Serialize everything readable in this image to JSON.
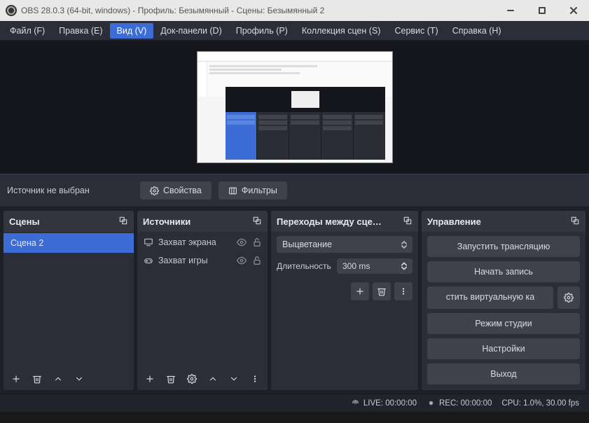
{
  "title": "OBS 28.0.3 (64-bit, windows) - Профиль: Безымянный - Сцены: Безымянный 2",
  "menubar": {
    "file": "Файл (F)",
    "edit": "Правка (E)",
    "view": "Вид (V)",
    "docks": "Док-панели (D)",
    "profile": "Профиль (P)",
    "scene_collection": "Коллекция сцен (S)",
    "tools": "Сервис (T)",
    "help": "Справка (H)"
  },
  "context": {
    "no_source": "Источник не выбран",
    "properties": "Свойства",
    "filters": "Фильтры"
  },
  "docks": {
    "scenes": {
      "title": "Сцены",
      "items": [
        "Сцена 2"
      ]
    },
    "sources": {
      "title": "Источники",
      "items": [
        {
          "label": "Захват экрана",
          "icon": "monitor"
        },
        {
          "label": "Захват игры",
          "icon": "gamepad"
        }
      ]
    },
    "transitions": {
      "title": "Переходы между сце…",
      "selected": "Выцветание",
      "duration_label": "Длительность",
      "duration_value": "300 ms"
    },
    "controls": {
      "title": "Управление",
      "start_stream": "Запустить трансляцию",
      "start_record": "Начать запись",
      "virtual_cam": "стить виртуальную ка",
      "studio_mode": "Режим студии",
      "settings": "Настройки",
      "exit": "Выход"
    }
  },
  "status": {
    "live": "LIVE: 00:00:00",
    "rec": "REC: 00:00:00",
    "cpu": "CPU: 1.0%, 30.00 fps"
  }
}
